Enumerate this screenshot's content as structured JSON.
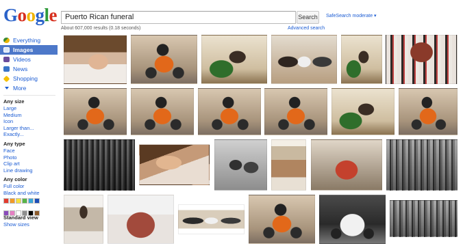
{
  "logo": {
    "letters": [
      "G",
      "o",
      "o",
      "g",
      "l",
      "e"
    ],
    "colors": [
      "#2a62c9",
      "#d7301f",
      "#f0b400",
      "#2a62c9",
      "#2f9a3a",
      "#d7301f"
    ]
  },
  "search": {
    "query": "Puerto Rican funeral",
    "button_label": "Search",
    "safesearch_label": "SafeSearch moderate ▾"
  },
  "results": {
    "stats": "About 607,000 results (0.18 seconds)",
    "advanced_label": "Advanced search"
  },
  "nav": {
    "items": [
      {
        "label": "Everything",
        "icon": "everything-icon",
        "active": false
      },
      {
        "label": "Images",
        "icon": "images-icon",
        "active": true
      },
      {
        "label": "Videos",
        "icon": "videos-icon",
        "active": false
      },
      {
        "label": "News",
        "icon": "news-icon",
        "active": false
      },
      {
        "label": "Shopping",
        "icon": "shopping-icon",
        "active": false
      },
      {
        "label": "More",
        "icon": "more-icon",
        "active": false
      }
    ]
  },
  "filters": {
    "size": {
      "title": "Any size",
      "options": [
        "Large",
        "Medium",
        "Icon",
        "Larger than...",
        "Exactly..."
      ]
    },
    "type": {
      "title": "Any type",
      "options": [
        "Face",
        "Photo",
        "Clip art",
        "Line drawing"
      ]
    },
    "color": {
      "title": "Any color",
      "options": [
        "Full color",
        "Black and white"
      ],
      "swatches": [
        "#e33b2e",
        "#f29b27",
        "#f6e13c",
        "#58b548",
        "#39a6d9",
        "#1d4fb8",
        "#8a4bbb",
        "#e57fc3",
        "#ffffff",
        "#8f8f8f",
        "#000000",
        "#8b5a2b"
      ]
    },
    "view": {
      "title": "Standard view",
      "link": "Show sizes"
    }
  },
  "images": [
    {
      "name": "image-result-cap-man",
      "variant": "t-cap"
    },
    {
      "name": "image-result-motorcycle",
      "variant": "t-bike"
    },
    {
      "name": "image-result-memorial-room",
      "variant": "t-room"
    },
    {
      "name": "image-result-family",
      "variant": "t-people"
    },
    {
      "name": "image-result-standing-man",
      "variant": "t-room"
    },
    {
      "name": "image-result-procession",
      "variant": "t-crowd"
    },
    {
      "name": "image-result-motorcycle-2",
      "variant": "t-bike"
    },
    {
      "name": "image-result-motorcycle-3",
      "variant": "t-bike"
    },
    {
      "name": "image-result-motorcycle-4",
      "variant": "t-bike"
    },
    {
      "name": "image-result-motorcycle-5",
      "variant": "t-bike"
    },
    {
      "name": "image-result-standing-man-2",
      "variant": "t-room"
    },
    {
      "name": "image-result-motorcycle-6",
      "variant": "t-bike"
    },
    {
      "name": "image-result-old-photo",
      "variant": "t-bw"
    },
    {
      "name": "image-result-cap-closeup",
      "variant": "t-face"
    },
    {
      "name": "image-result-bw-street",
      "variant": "t-bw2"
    },
    {
      "name": "image-result-card",
      "variant": "t-card"
    },
    {
      "name": "image-result-cuba-man",
      "variant": "t-cuba"
    },
    {
      "name": "image-result-bw-crowd",
      "variant": "t-bwwide"
    },
    {
      "name": "image-result-standing-man-3",
      "variant": "t-stand"
    },
    {
      "name": "image-result-casket",
      "variant": "t-casket"
    },
    {
      "name": "image-result-trio",
      "variant": "t-trio"
    },
    {
      "name": "image-result-motorcycle-7",
      "variant": "t-bike"
    },
    {
      "name": "image-result-hearse-car",
      "variant": "t-car"
    },
    {
      "name": "image-result-bw-group",
      "variant": "t-bwwide"
    }
  ]
}
